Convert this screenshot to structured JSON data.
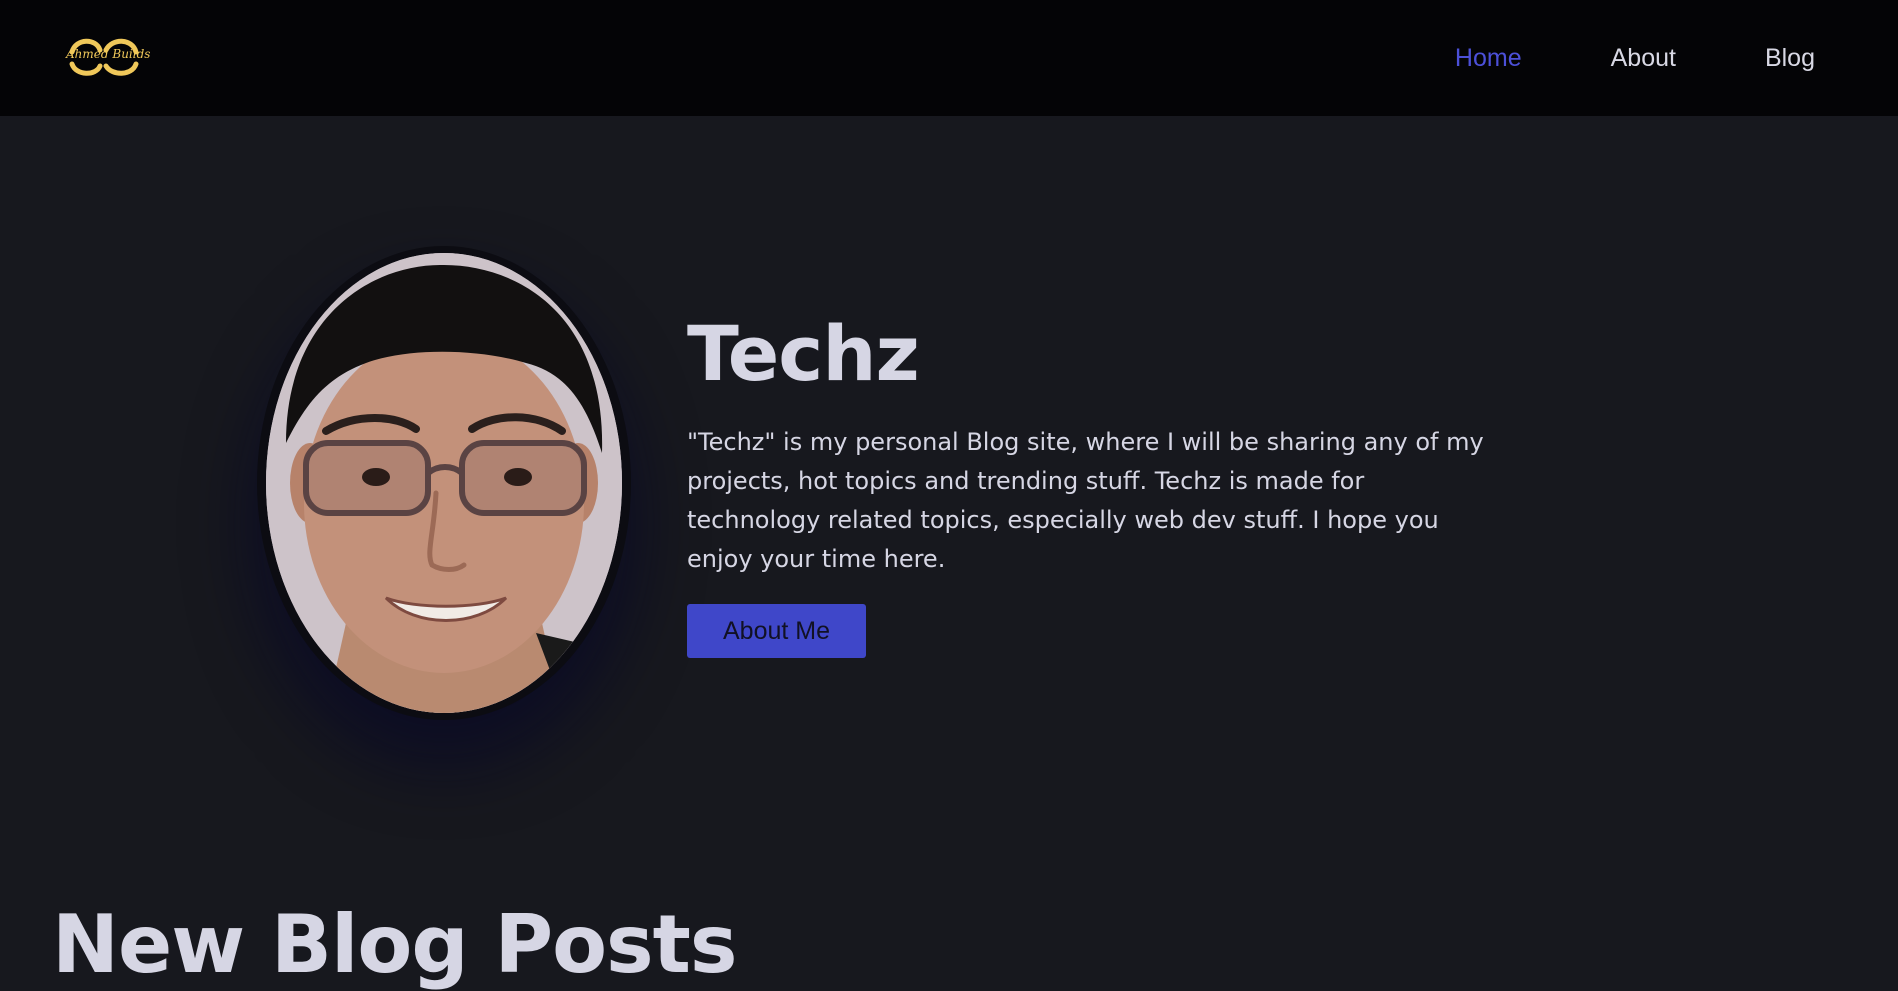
{
  "header": {
    "logo_text": "Ahmed Builds",
    "logo_color": "#f0c85a",
    "nav": [
      {
        "label": "Home",
        "active": true
      },
      {
        "label": "About",
        "active": false
      },
      {
        "label": "Blog",
        "active": false
      }
    ],
    "active_color": "#4c50d8"
  },
  "hero": {
    "title": "Techz",
    "description": "\"Techz\" is my personal Blog site, where I will be sharing any of my projects, hot topics and trending stuff. Techz is made for technology related topics, especially web dev stuff. I hope you enjoy your time here.",
    "button_label": "About Me",
    "button_color": "#3f47c9"
  },
  "section": {
    "title": "New Blog Posts"
  }
}
